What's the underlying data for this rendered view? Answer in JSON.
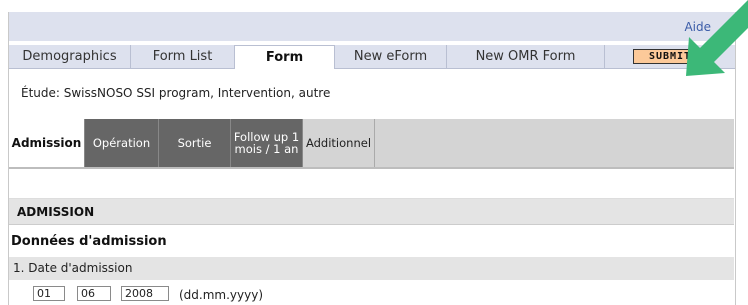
{
  "header": {
    "help_link": "Aide"
  },
  "main_tabs": [
    {
      "label": "Demographics"
    },
    {
      "label": "Form List"
    },
    {
      "label": "Form"
    },
    {
      "label": "New eForm"
    },
    {
      "label": "New OMR Form"
    }
  ],
  "submit_label": "SUBMIT",
  "study_line": "Étude: SwissNOSO SSI program, Intervention, autre",
  "sub_tabs": [
    {
      "label": "Admission"
    },
    {
      "label": "Opération"
    },
    {
      "label": "Sortie"
    },
    {
      "label": "Follow up 1 mois / 1 an"
    },
    {
      "label": "Additionnel"
    }
  ],
  "section_title": "ADMISSION",
  "group_title": "Données d'admission",
  "question": {
    "label": "1. Date d'admission",
    "day": "01",
    "month": "06",
    "year": "2008",
    "format_hint": "(dd.mm.yyyy)"
  },
  "colors": {
    "submit_bg": "#fcc999",
    "arrow": "#3cb878",
    "tab_bar": "#dde1ee"
  },
  "icons": {
    "pointer": "green-arrow-icon"
  }
}
